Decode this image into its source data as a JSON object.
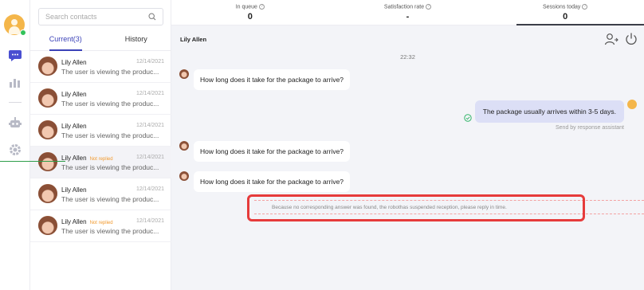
{
  "sidebar": {
    "icons": [
      "chat-icon",
      "analytics-icon",
      "robot-icon",
      "settings-icon"
    ]
  },
  "contacts": {
    "search_placeholder": "Search contacts",
    "tabs": [
      {
        "label": "Current(3)",
        "active": true
      },
      {
        "label": "History",
        "active": false
      }
    ],
    "items": [
      {
        "name": "Lily Allen",
        "badge": "",
        "date": "12/14/2021",
        "message": "The user is viewing the produc..."
      },
      {
        "name": "Lily Allen",
        "badge": "",
        "date": "12/14/2021",
        "message": "The user is viewing the produc..."
      },
      {
        "name": "Lily Allen",
        "badge": "",
        "date": "12/14/2021",
        "message": "The user is viewing the produc..."
      },
      {
        "name": "Lily Allen",
        "badge": "Not replied",
        "date": "12/14/2021",
        "message": "The user is viewing the produc..."
      },
      {
        "name": "Lily Allen",
        "badge": "",
        "date": "12/14/2021",
        "message": "The user is viewing the produc..."
      },
      {
        "name": "Lily Allen",
        "badge": "Not replied",
        "date": "12/14/2021",
        "message": "The user is viewing the produc..."
      }
    ]
  },
  "stats": [
    {
      "label": "In queue",
      "value": "0"
    },
    {
      "label": "Satisfaction rate",
      "value": "-"
    },
    {
      "label": "Sessions today",
      "value": "0"
    }
  ],
  "chat": {
    "contact_name": "Lily Allen",
    "time": "22:32",
    "incoming": [
      "How long does it take for the package to arrive?",
      "How long does it take for the package to arrive?",
      "How long does it take for the package to arrive?"
    ],
    "outgoing": "The package usually arrives within 3-5 days.",
    "sent_by": "Send by response assistant",
    "notice": "Because no corresponding answer was found, the robothas suspended reception, please reply in time."
  },
  "colors": {
    "accent": "#3b42b8",
    "badge": "#f29a2e",
    "highlight": "#e63b3b",
    "outgoing_bubble": "#dcdff6"
  }
}
